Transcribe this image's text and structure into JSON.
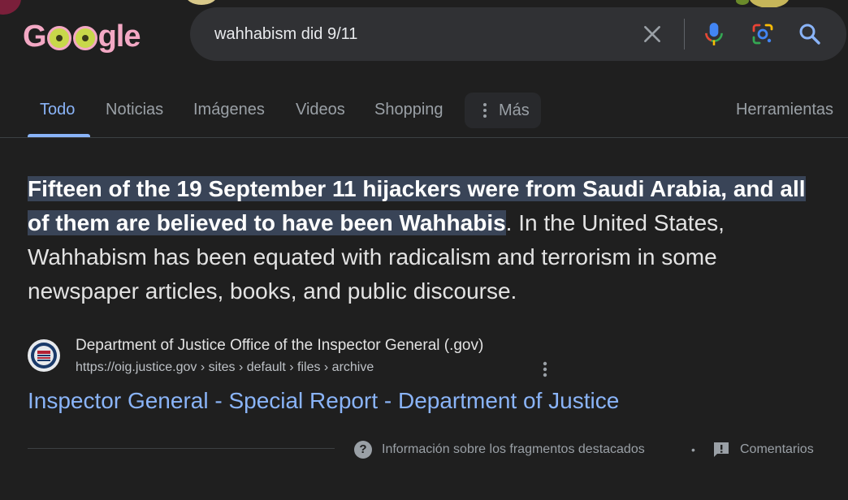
{
  "logo": {
    "text_g": "G",
    "text_gle": "gle"
  },
  "search": {
    "query": "wahhabism did 9/11"
  },
  "tabs": [
    {
      "label": "Todo"
    },
    {
      "label": "Noticias"
    },
    {
      "label": "Imágenes"
    },
    {
      "label": "Videos"
    },
    {
      "label": "Shopping"
    }
  ],
  "more_label": "Más",
  "tools_label": "Herramientas",
  "snippet": {
    "highlight": "Fifteen of the 19 September 11 hijackers were from Saudi Arabia, and all of them are believed to have been Wahhabis",
    "rest": ". In the United States, Wahhabism has been equated with radicalism and terrorism in some newspaper articles, books, and public discourse."
  },
  "source": {
    "name": "Department of Justice Office of the Inspector General (.gov)",
    "url": "https://oig.justice.gov › sites › default › files › archive"
  },
  "result_title": "Inspector General - Special Report - Department of Justice",
  "footer": {
    "about": "Información sobre los fragmentos destacados",
    "separator": "•",
    "feedback": "Comentarios"
  },
  "colors": {
    "background": "#1f1f1f",
    "link": "#8ab4f8",
    "highlight": "#394457",
    "search_box": "#303134"
  }
}
